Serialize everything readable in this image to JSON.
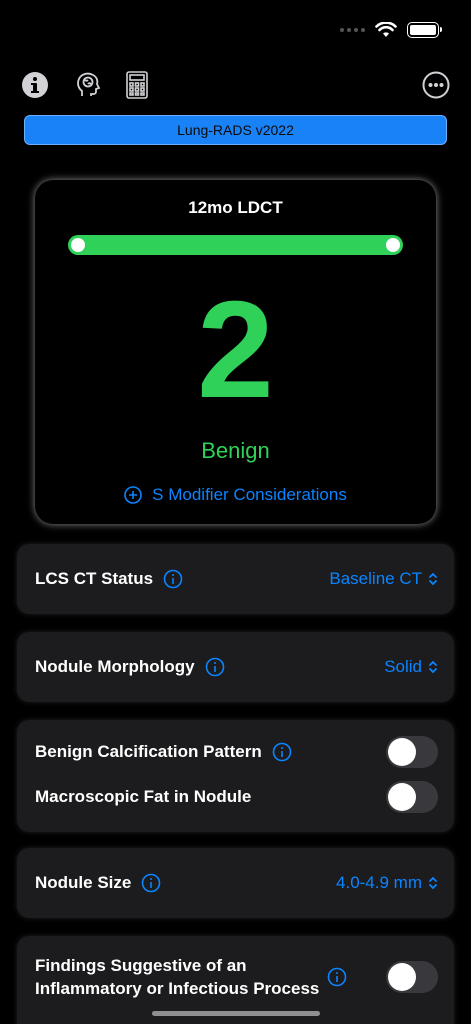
{
  "header": {
    "version_label": "Lung-RADS v2022"
  },
  "result": {
    "title": "12mo LDCT",
    "progress": 1.0,
    "score": "2",
    "category": "Benign",
    "modifier_link": "S Modifier Considerations"
  },
  "settings": {
    "ct_status": {
      "label": "LCS CT Status",
      "value": "Baseline CT"
    },
    "morphology": {
      "label": "Nodule Morphology",
      "value": "Solid"
    },
    "calcification": {
      "label": "Benign Calcification Pattern",
      "on": false
    },
    "fat": {
      "label": "Macroscopic Fat in Nodule",
      "on": false
    },
    "size": {
      "label": "Nodule Size",
      "value": "4.0-4.9 mm"
    },
    "inflammatory": {
      "label_line1": "Findings Suggestive of an",
      "label_line2": "Inflammatory or Infectious Process",
      "on": false
    }
  },
  "icons": {
    "info": "info-icon",
    "brain": "brain-head-icon",
    "calculator": "calculator-icon",
    "more": "ellipsis-circle-icon"
  },
  "colors": {
    "accent_blue": "#0a84ff",
    "version_bar": "#1a82f7",
    "benign_green": "#30d158",
    "card_bg": "#1c1c1e"
  }
}
